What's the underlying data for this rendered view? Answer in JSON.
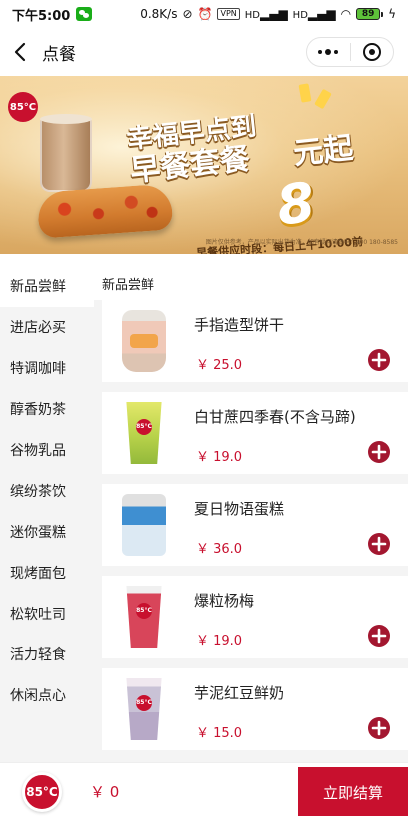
{
  "status_bar": {
    "time": "下午5:00",
    "net_speed": "0.8K/s",
    "battery": "89",
    "vpn": "VPN",
    "hd1": "HD",
    "hd2": "HD"
  },
  "nav": {
    "title": "点餐",
    "back_icon": "chevron-left-icon",
    "more_icon": "more-dots-icon",
    "close_icon": "target-close-icon"
  },
  "banner": {
    "logo": "85°C",
    "headline_line1": "幸福早点到",
    "headline_line2": "早餐套餐",
    "big_number": "8",
    "headline_suffix": "元起",
    "subline": "早餐供应时段：每日上午10:00前",
    "note": "图片仅供参考，产品以实际出货为准，如有疑问请致电：400 180-8585"
  },
  "sidebar": {
    "items": [
      {
        "label": "新品尝鲜",
        "active": true
      },
      {
        "label": "进店必买",
        "active": false
      },
      {
        "label": "特调咖啡",
        "active": false
      },
      {
        "label": "醇香奶茶",
        "active": false
      },
      {
        "label": "谷物乳品",
        "active": false
      },
      {
        "label": "缤纷茶饮",
        "active": false
      },
      {
        "label": "迷你蛋糕",
        "active": false
      },
      {
        "label": "现烤面包",
        "active": false
      },
      {
        "label": "松软吐司",
        "active": false
      },
      {
        "label": "活力轻食",
        "active": false
      },
      {
        "label": "休闲点心",
        "active": false
      }
    ]
  },
  "main": {
    "section_title": "新品尝鲜",
    "products": [
      {
        "name": "手指造型饼干",
        "price": "￥ 25.0",
        "thumb": "cookie-jar",
        "thumb_label": ""
      },
      {
        "name": "白甘蔗四季春(不含马蹄)",
        "price": "￥ 19.0",
        "thumb": "juice-cup",
        "thumb_label": "85°C"
      },
      {
        "name": "夏日物语蛋糕",
        "price": "￥ 36.0",
        "thumb": "cake-box",
        "thumb_label": ""
      },
      {
        "name": "爆粒杨梅",
        "price": "￥ 19.0",
        "thumb": "berry-cup",
        "thumb_label": "85°C"
      },
      {
        "name": "芋泥红豆鲜奶",
        "price": "￥ 15.0",
        "thumb": "taro-cup",
        "thumb_label": "85°C"
      }
    ],
    "add_icon": "plus-circle-icon"
  },
  "bottom_bar": {
    "logo": "85°C",
    "total": "￥ 0",
    "checkout_label": "立即结算"
  },
  "colors": {
    "brand_red": "#c8102e",
    "add_button": "#a31730",
    "sidebar_bg": "#f4f4f4"
  }
}
